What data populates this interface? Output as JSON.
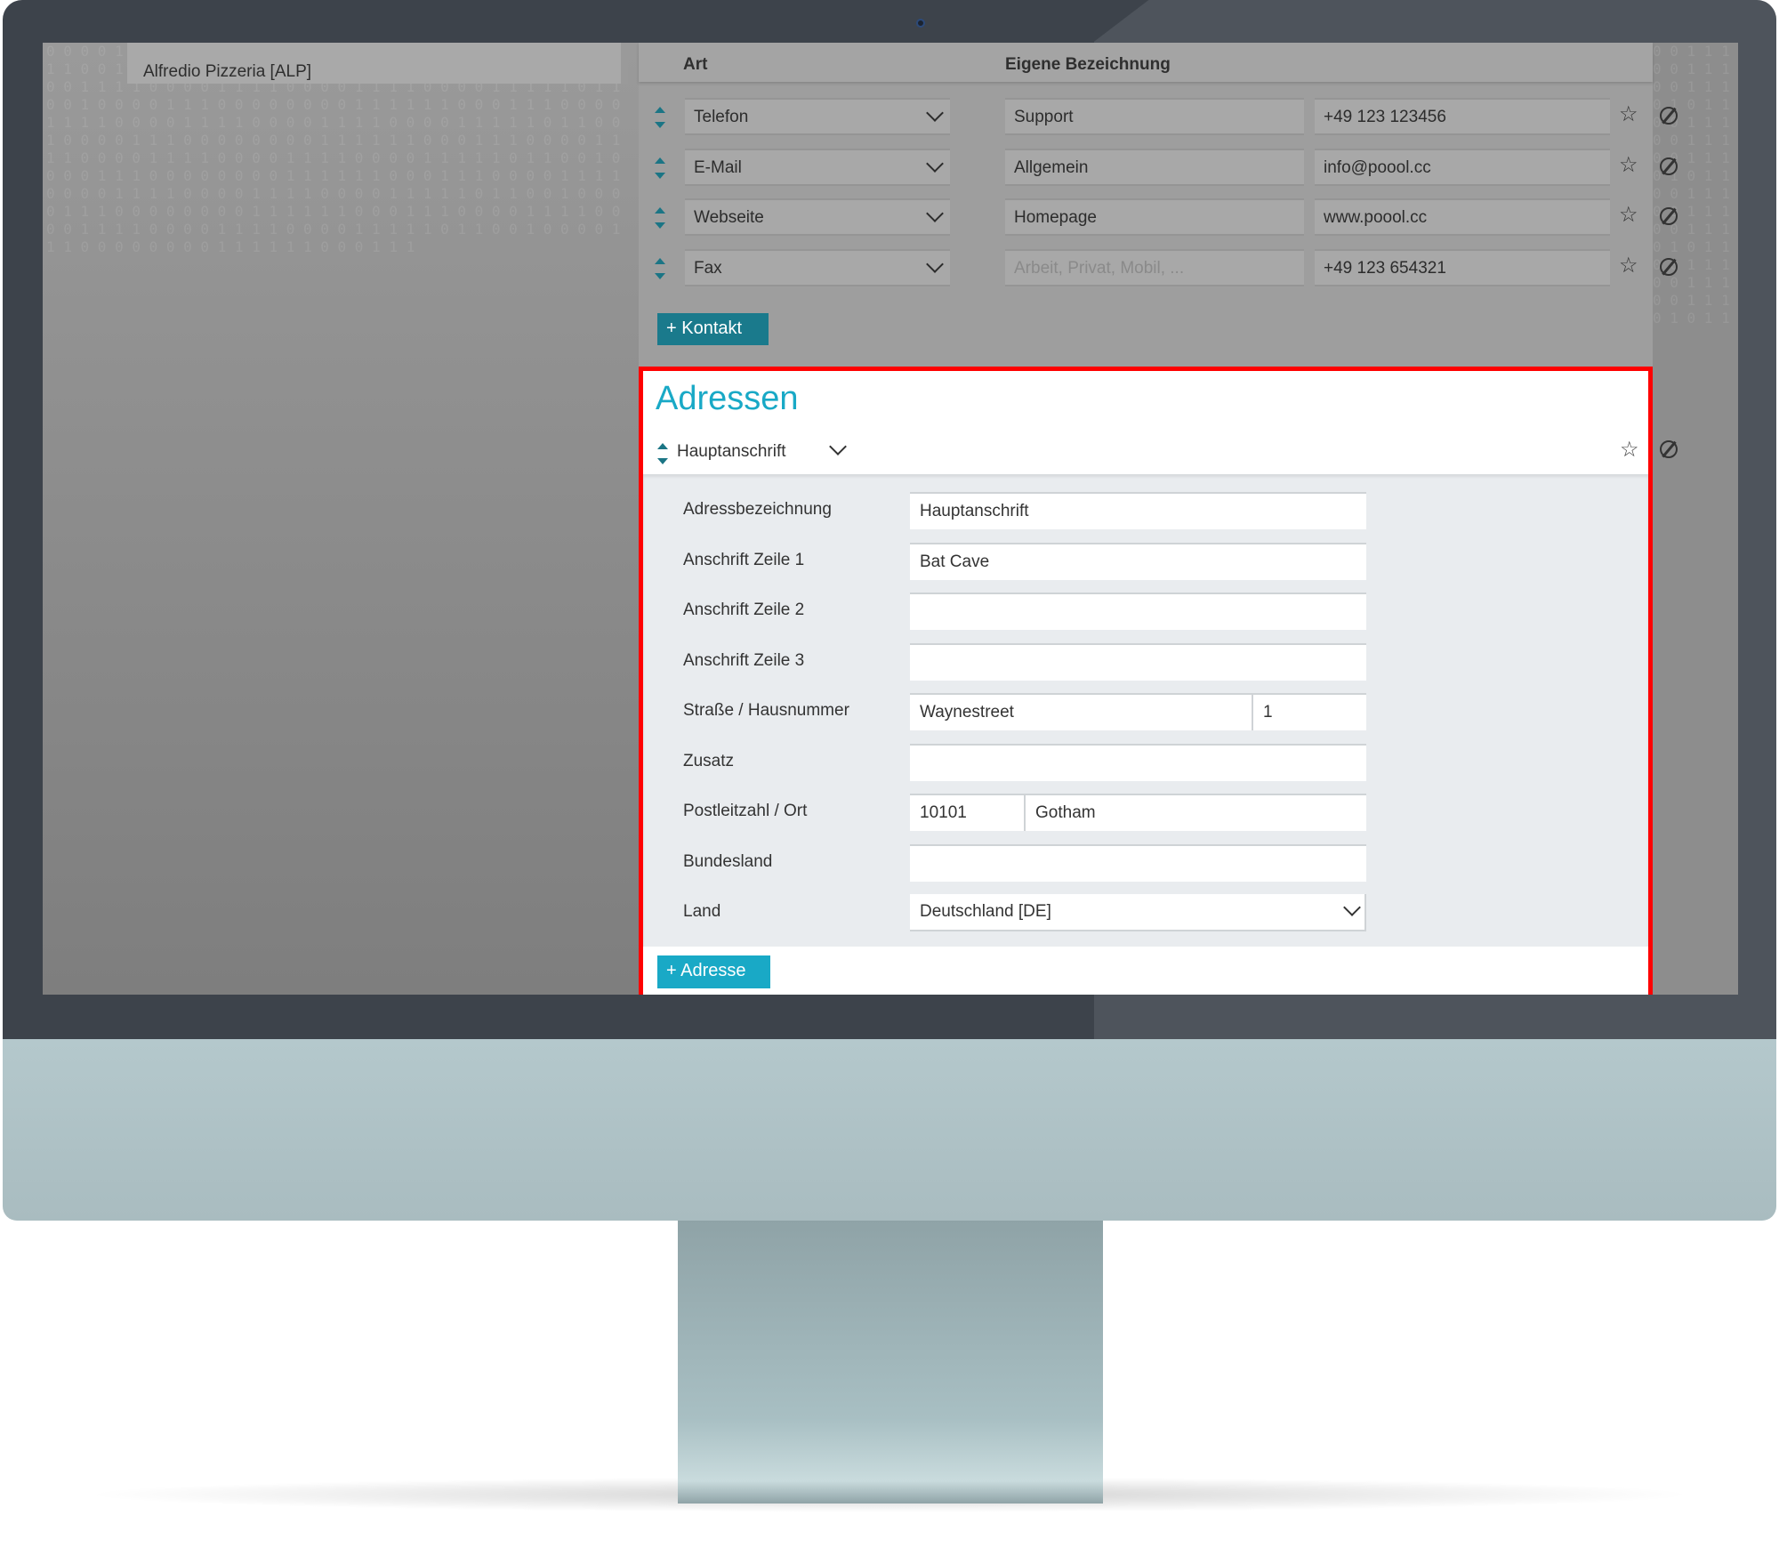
{
  "tab": {
    "label": "Alfredio Pizzeria [ALP]"
  },
  "contacts": {
    "headers": {
      "type": "Art",
      "label": "Eigene Bezeichnung"
    },
    "rows": [
      {
        "type": "Telefon",
        "label": "Support",
        "label_placeholder": "",
        "value": "+49 123 123456"
      },
      {
        "type": "E-Mail",
        "label": "Allgemein",
        "label_placeholder": "",
        "value": "info@poool.cc"
      },
      {
        "type": "Webseite",
        "label": "Homepage",
        "label_placeholder": "",
        "value": "www.poool.cc"
      },
      {
        "type": "Fax",
        "label": "",
        "label_placeholder": "Arbeit, Privat, Mobil, ...",
        "value": "+49 123 654321"
      }
    ],
    "add_button": "Kontakt"
  },
  "addresses": {
    "title": "Adressen",
    "selected": "Hauptanschrift",
    "fields": {
      "bezeichnung": {
        "label": "Adressbezeichnung",
        "value": "Hauptanschrift"
      },
      "zeile1": {
        "label": "Anschrift Zeile 1",
        "value": "Bat Cave"
      },
      "zeile2": {
        "label": "Anschrift Zeile 2",
        "value": ""
      },
      "zeile3": {
        "label": "Anschrift Zeile 3",
        "value": ""
      },
      "strasse": {
        "label": "Straße / Hausnummer",
        "street": "Waynestreet",
        "number": "1"
      },
      "zusatz": {
        "label": "Zusatz",
        "value": ""
      },
      "plzort": {
        "label": "Postleitzahl / Ort",
        "plz": "10101",
        "ort": "Gotham"
      },
      "bundesland": {
        "label": "Bundesland",
        "value": ""
      },
      "land": {
        "label": "Land",
        "value": "Deutschland [DE]"
      }
    },
    "add_button": "Adresse"
  },
  "colors": {
    "accent": "#19a9c6",
    "highlight": "#ff0000"
  }
}
